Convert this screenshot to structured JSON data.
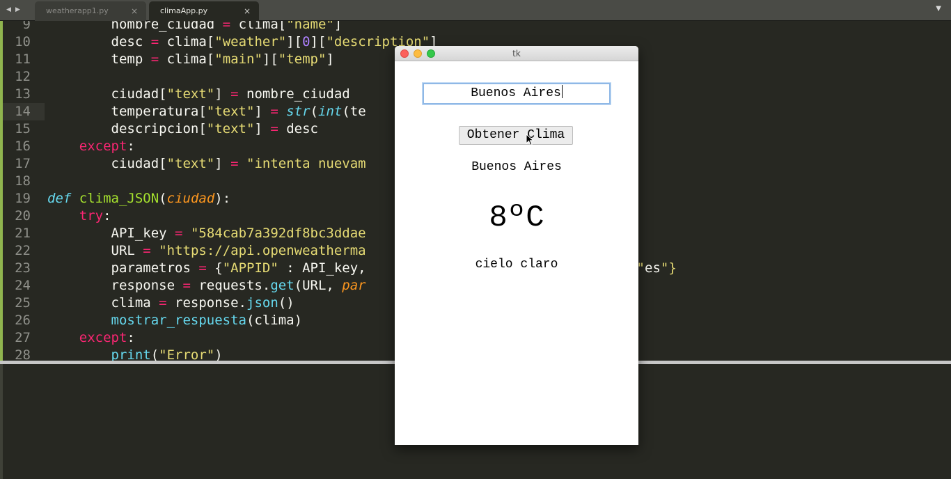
{
  "tabs": [
    {
      "label": "weatherapp1.py",
      "close": "×"
    },
    {
      "label": "climaApp.py",
      "close": "×"
    }
  ],
  "editor": {
    "line_numbers": [
      "9",
      "10",
      "11",
      "12",
      "13",
      "14",
      "15",
      "16",
      "17",
      "18",
      "19",
      "20",
      "21",
      "22",
      "23",
      "24",
      "25",
      "26",
      "27",
      "28"
    ],
    "lines": [
      "        nombre_ciudad = clima[\"name\"]",
      "        desc = clima[\"weather\"][0][\"description\"]",
      "        temp = clima[\"main\"][\"temp\"]",
      "",
      "        ciudad[\"text\"] = nombre_ciudad",
      "        temperatura[\"text\"] = str(int(te",
      "        descripcion[\"text\"] = desc",
      "    except:",
      "        ciudad[\"text\"] = \"intenta nuevam",
      "",
      "def clima_JSON(ciudad):",
      "    try:",
      "        API_key = \"584cab7a392df8bc3ddae",
      "        URL = \"https://api.openweatherma",
      "        parametros = {\"APPID\" : API_key,                    ric\", \"lang\": \"es\"}",
      "        response = requests.get(URL, par",
      "        clima = response.json()",
      "        mostrar_respuesta(clima)",
      "    except:",
      "        print(\"Error\")"
    ]
  },
  "tk_window": {
    "title": "tk",
    "entry_value": "Buenos Aires",
    "button_label": "Obtener Clima",
    "city": "Buenos Aires",
    "temperature": "8ºC",
    "description": "cielo claro"
  },
  "icons": {
    "nav_back": "◀",
    "nav_forward": "▶",
    "dropdown": "▼"
  },
  "colors": {
    "editor_bg": "#272822",
    "keyword": "#f92672",
    "string": "#e6db74",
    "number": "#ae81ff",
    "function": "#a6e22e"
  }
}
